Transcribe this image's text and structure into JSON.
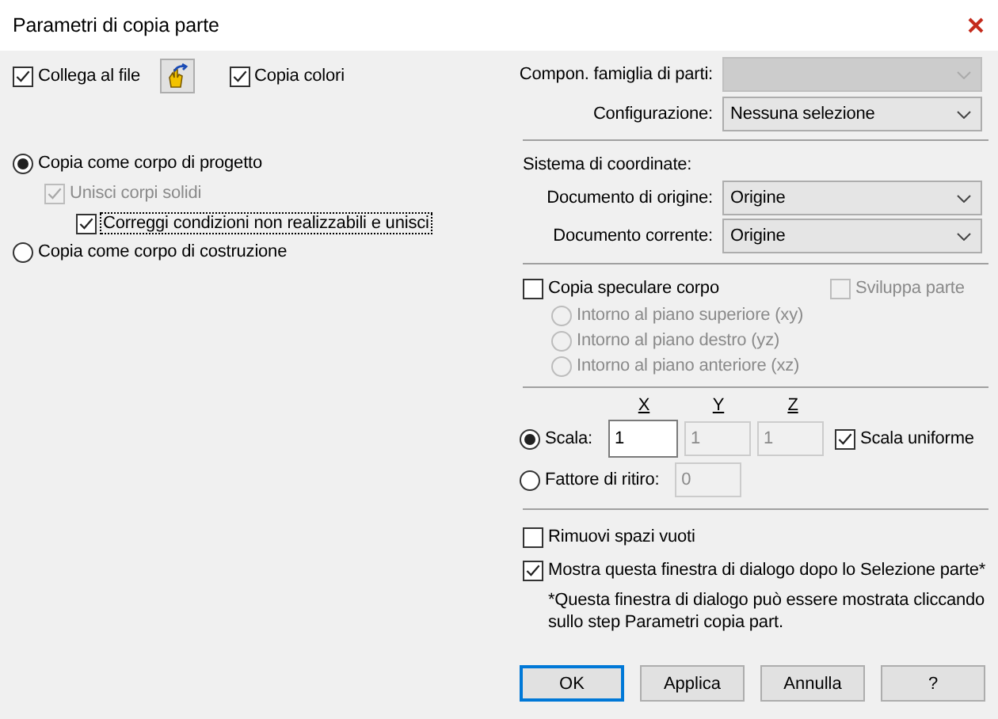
{
  "window": {
    "title": "Parametri di copia parte"
  },
  "link_file": {
    "label": "Collega al file",
    "checked": true
  },
  "copy_colors": {
    "label": "Copia colori",
    "checked": true
  },
  "body_type": [
    {
      "label": "Copia come corpo di progetto",
      "selected": true,
      "children": [
        {
          "label": "Unisci corpi solidi",
          "checked": true,
          "disabled": true,
          "focused": false,
          "children": [
            {
              "label": "Correggi condizioni non realizzabili e unisci",
              "checked": true,
              "disabled": false,
              "focused": true
            }
          ]
        }
      ]
    },
    {
      "label": "Copia come corpo di costruzione",
      "selected": false
    }
  ],
  "family_component": {
    "label": "Compon. famiglia di parti:",
    "disabled": true
  },
  "configuration": {
    "label": "Configurazione:",
    "value": "Nessuna selezione",
    "disabled": false
  },
  "coordinate_system": {
    "heading": "Sistema di coordinate:",
    "fields": [
      {
        "label": "Documento di origine:",
        "value": "Origine",
        "disabled": false
      },
      {
        "label": "Documento corrente:",
        "value": "Origine",
        "disabled": false
      }
    ]
  },
  "mirror": {
    "label": "Copia speculare corpo",
    "checked": false,
    "disabled": false
  },
  "develop_part": {
    "label": "Sviluppa parte",
    "checked": false,
    "disabled": true
  },
  "mirror_planes": [
    {
      "label": "Intorno al piano superiore (xy)",
      "selected": false,
      "disabled": true
    },
    {
      "label": "Intorno al piano destro (yz)",
      "selected": false,
      "disabled": true
    },
    {
      "label": "Intorno al piano anteriore (xz)",
      "selected": false,
      "disabled": true
    }
  ],
  "scale_axes": [
    "X",
    "Y",
    "Z"
  ],
  "scale_modes": [
    {
      "label": "Scala:",
      "selected": true,
      "fields": [
        {
          "value": "1",
          "disabled": false
        },
        {
          "value": "1",
          "disabled": true
        },
        {
          "value": "1",
          "disabled": true
        }
      ]
    },
    {
      "label": "Fattore di ritiro:",
      "selected": false,
      "fields": [
        {
          "value": "0",
          "disabled": true
        }
      ]
    }
  ],
  "uniform_scale": {
    "label": "Scala uniforme",
    "checked": true,
    "disabled": false
  },
  "remove_gaps": {
    "label": "Rimuovi spazi vuoti",
    "checked": false,
    "disabled": false
  },
  "show_dialog": {
    "label": "Mostra questa finestra di dialogo dopo lo Selezione parte*",
    "checked": true,
    "disabled": false
  },
  "note": "*Questa finestra di dialogo può essere mostrata cliccando\nsullo step Parametri copia part.",
  "buttons": [
    {
      "label": "OK",
      "default": true
    },
    {
      "label": "Applica",
      "default": false
    },
    {
      "label": "Annulla",
      "default": false
    },
    {
      "label": "?",
      "default": false
    }
  ]
}
